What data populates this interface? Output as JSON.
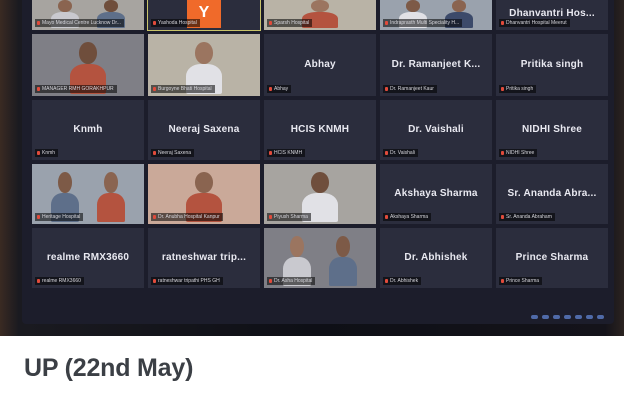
{
  "caption": "UP (22nd May)",
  "colors": {
    "tile_bg": "#2b2d3d",
    "screen_bg": "#1c1d2b",
    "avatar_accent": "#f06a2a",
    "active_outline": "#c9c46a",
    "mic_muted": "#e14b3b"
  },
  "grid": {
    "rows": [
      [
        {
          "type": "video",
          "label": "Mayo Medical Centre Lucknow Dr..."
        },
        {
          "type": "avatar",
          "avatar_letter": "Y",
          "label": "Yashoda Hospital",
          "active": true
        },
        {
          "type": "video",
          "label": "Sparsh Hospital"
        },
        {
          "type": "video",
          "label": "Indraprasth Multi Speciality H..."
        },
        {
          "type": "name",
          "name": "Dhanvantri Hos...",
          "label": "Dhanvantri Hospital Meerut"
        }
      ],
      [
        {
          "type": "video",
          "label": "MANAGER RMH GORAKHPUR"
        },
        {
          "type": "video",
          "label": "Burgoyne Bhati Hospital"
        },
        {
          "type": "name",
          "name": "Abhay",
          "label": "Abhay"
        },
        {
          "type": "name",
          "name": "Dr. Ramanjeet K...",
          "label": "Dr. Ramanjeet Kaur"
        },
        {
          "type": "name",
          "name": "Pritika singh",
          "label": "Pritika singh"
        }
      ],
      [
        {
          "type": "name",
          "name": "Knmh",
          "label": "Knmh"
        },
        {
          "type": "name",
          "name": "Neeraj Saxena",
          "label": "Neeraj Saxena"
        },
        {
          "type": "name",
          "name": "HCIS KNMH",
          "label": "HCIS KNMH"
        },
        {
          "type": "name",
          "name": "Dr. Vaishali",
          "label": "Dr. Vaishali"
        },
        {
          "type": "name",
          "name": "NIDHI Shree",
          "label": "NIDHI Shree"
        }
      ],
      [
        {
          "type": "video",
          "label": "Heritage Hospital"
        },
        {
          "type": "video",
          "label": "Dr. Anubha Hospital Kanpur"
        },
        {
          "type": "video",
          "label": "Piyush Sharma"
        },
        {
          "type": "name",
          "name": "Akshaya Sharma",
          "label": "Akshaya Sharma"
        },
        {
          "type": "name",
          "name": "Sr. Ananda Abra...",
          "label": "Sr. Ananda Abraham"
        }
      ],
      [
        {
          "type": "name",
          "name": "realme RMX3660",
          "label": "realme RMX3660"
        },
        {
          "type": "name",
          "name": "ratneshwar trip...",
          "label": "ratneshwar tripathi PHS GH"
        },
        {
          "type": "video",
          "label": "Dr. Asha Hospital"
        },
        {
          "type": "name",
          "name": "Dr. Abhishek",
          "label": "Dr. Abhishek"
        },
        {
          "type": "name",
          "name": "Prince Sharma",
          "label": "Prince Sharma"
        }
      ]
    ]
  }
}
